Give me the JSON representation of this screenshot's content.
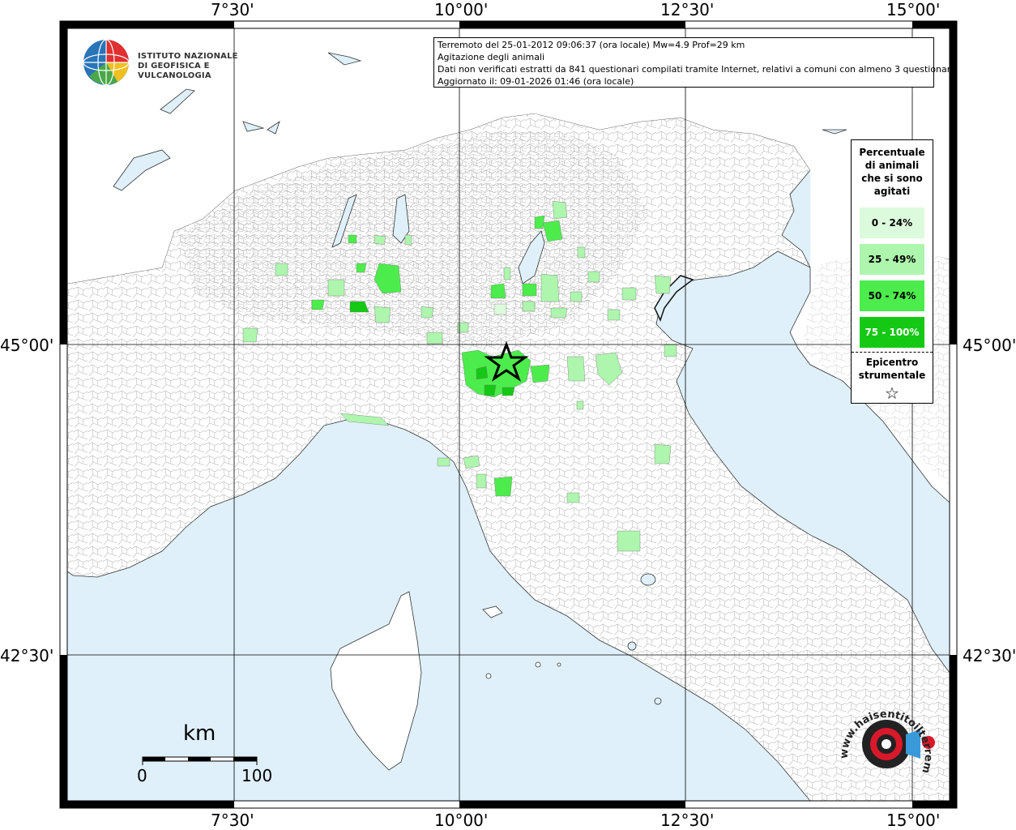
{
  "map": {
    "graticule": {
      "longitudes": [
        "7°30'",
        "10°00'",
        "12°30'",
        "15°00'"
      ],
      "latitudes": [
        "45°00'",
        "42°30'"
      ]
    },
    "colors": {
      "sea": "#dff0fb",
      "land": "#ffffff",
      "border_lines": "#aaaaaa",
      "class_0_24": "#dcfadc",
      "class_25_49": "#aef5ae",
      "class_50_74": "#4cec4c",
      "class_75_100": "#14c814"
    },
    "epicenter": {
      "lon": 10.95,
      "lat": 44.87
    }
  },
  "info": {
    "line1": "Terremoto del 25-01-2012 09:06:37 (ora locale) Mw=4.9 Prof=29 km",
    "line2": "Agitazione degli animali",
    "line3": "Dati non verificati estratti da 841 questionari compilati tramite Internet, relativi a comuni con almeno 3 questionari.",
    "line4": "Aggiornato il: 09-01-2026 01:46 (ora locale)"
  },
  "logo": {
    "line1": "ISTITUTO NAZIONALE",
    "line2": "DI GEOFISICA E VULCANOLOGIA"
  },
  "legend": {
    "title_lines": [
      "Percentuale",
      "di animali",
      "che si sono",
      "agitati"
    ],
    "classes": [
      {
        "label": "0 - 24%",
        "color": "#dcfadc",
        "text_color": "#000000"
      },
      {
        "label": "25 - 49%",
        "color": "#aef5ae",
        "text_color": "#000000"
      },
      {
        "label": "50 - 74%",
        "color": "#4cec4c",
        "text_color": "#000000"
      },
      {
        "label": "75 - 100%",
        "color": "#14c814",
        "text_color": "#ffffff"
      }
    ],
    "epicenter_lines": [
      "Epicentro",
      "strumentale"
    ],
    "epicenter_symbol": "☆"
  },
  "scale": {
    "unit": "km",
    "min_label": "0",
    "max_label": "100"
  },
  "branding": {
    "site": "www.haisentitoilterremoto.it"
  }
}
